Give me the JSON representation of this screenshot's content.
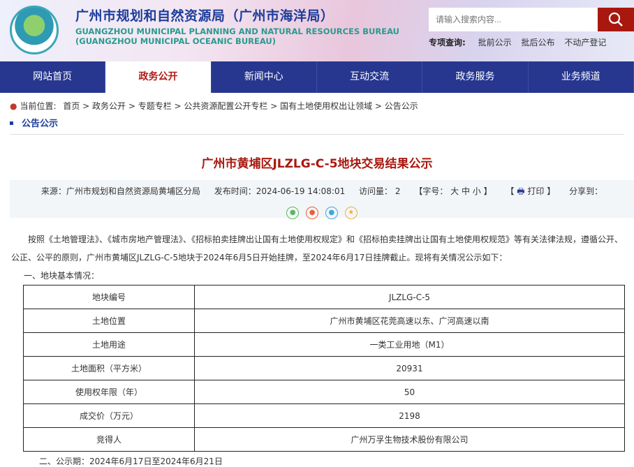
{
  "header": {
    "title": "广州市规划和自然资源局（广州市海洋局）",
    "en1": "GUANGZHOU MUNICIPAL PLANNING AND NATURAL RESOURCES BUREAU",
    "en2": "(GUANGZHOU MUNICIPAL OCEANIC BUREAU)",
    "search_placeholder": "请输入搜索内容...",
    "quick_label": "专项查询:",
    "quick_links": [
      "批前公示",
      "批后公布",
      "不动产登记"
    ]
  },
  "nav": [
    "网站首页",
    "政务公开",
    "新闻中心",
    "互动交流",
    "政务服务",
    "业务频道"
  ],
  "breadcrumb": {
    "label": "当前位置:",
    "items": "首页 > 政务公开 > 专题专栏 > 公共资源配置公开专栏 > 国有土地使用权出让领域 > 公告公示"
  },
  "section": "公告公示",
  "article": {
    "title": "广州市黄埔区JLZLG-C-5地块交易结果公示",
    "source": "来源：广州市规划和自然资源局黄埔区分局",
    "time": "发布时间：2024-06-19 14:08:01",
    "views": "访问量：  2",
    "font": "【字号： 大  中  小 】",
    "print": "打印 】",
    "share": "分享到：",
    "para1": "按照《土地管理法》、《城市房地产管理法》、《招标拍卖挂牌出让国有土地使用权规定》和《招标拍卖挂牌出让国有土地使用权规范》等有关法律法规，遵循公开、公正、公平的原则，广州市黄埔区JLZLG-C-5地块于2024年6月5日开始挂牌，至2024年6月17日挂牌截止。现将有关情况公示如下：",
    "para2": "一、地块基本情况：",
    "rows": [
      [
        "地块编号",
        "JLZLG-C-5"
      ],
      [
        "土地位置",
        "广州市黄埔区花莞高速以东、广河高速以南"
      ],
      [
        "土地用途",
        "一类工业用地（M1）"
      ],
      [
        "土地面积（平方米）",
        "20931"
      ],
      [
        "使用权年限（年）",
        "50"
      ],
      [
        "成交价（万元）",
        "2198"
      ],
      [
        "竞得人",
        "广州万孚生物技术股份有限公司"
      ]
    ],
    "tail": "二、公示期：2024年6月17日至2024年6月21日"
  }
}
